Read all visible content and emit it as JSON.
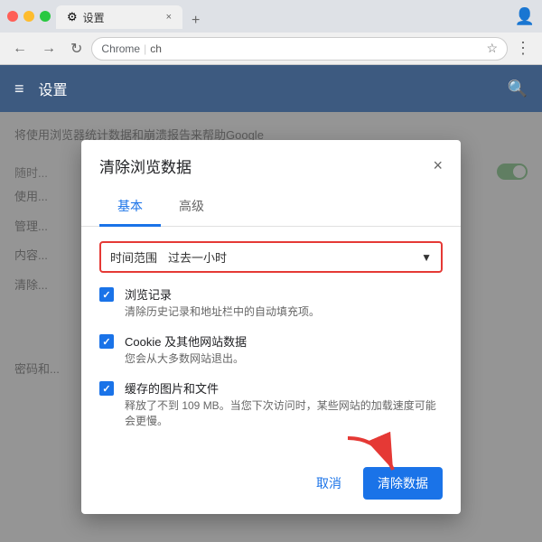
{
  "browser": {
    "tab_icon": "⚙",
    "tab_label": "设置",
    "tab_close": "×",
    "new_tab_icon": "+",
    "nav_back": "←",
    "nav_forward": "→",
    "nav_refresh": "↻",
    "address_secure": "Chrome",
    "address_text": "ch",
    "address_star": "☆",
    "nav_more": "⋮",
    "profile_icon": "👤"
  },
  "settings_page": {
    "hamburger": "≡",
    "title": "设置",
    "search_icon": "🔍",
    "bg_text1": "将使用浏览器统计数据和崩溃报告来帮助Google",
    "bg_text2": "随时...",
    "bg_text3": "使用...",
    "bg_text4": "管理...",
    "bg_text5": "内容...",
    "bg_text6": "清除...",
    "bg_text7": "密码和..."
  },
  "dialog": {
    "title": "清除浏览数据",
    "close_btn": "×",
    "tab_basic": "基本",
    "tab_advanced": "高级",
    "time_range_label": "时间范围",
    "time_range_value": "过去一小时",
    "time_range_arrow": "▼",
    "items": [
      {
        "title": "浏览记录",
        "desc": "清除历史记录和地址栏中的自动填充项。",
        "checked": true
      },
      {
        "title": "Cookie 及其他网站数据",
        "desc": "您会从大多数网站退出。",
        "checked": true
      },
      {
        "title": "缓存的图片和文件",
        "desc": "释放了不到 109 MB。当您下次访问时，某些网站的加载速度可能会更慢。",
        "checked": true
      }
    ],
    "cancel_label": "取消",
    "clear_label": "清除数据"
  }
}
